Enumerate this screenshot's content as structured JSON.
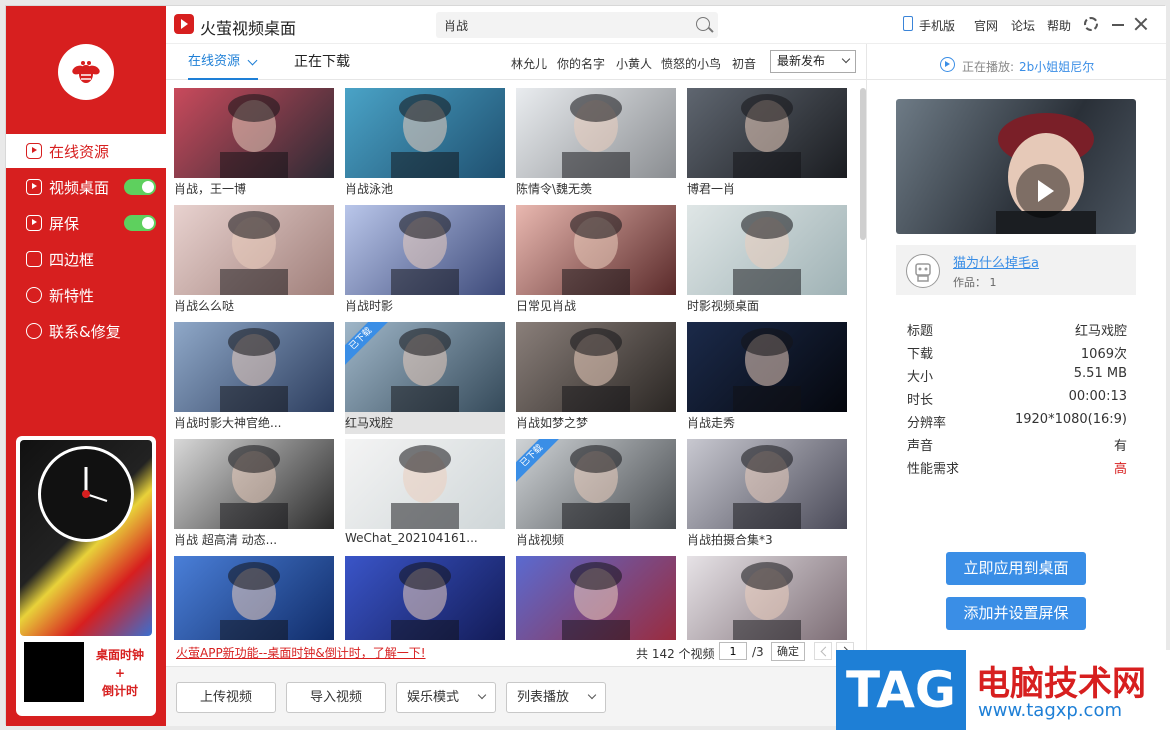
{
  "app": {
    "title": "火萤视频桌面"
  },
  "search": {
    "value": "肖战"
  },
  "toolbar": {
    "phone": "手机版",
    "official": "官网",
    "forum": "论坛",
    "help": "帮助"
  },
  "sidebar": {
    "items": [
      {
        "label": "在线资源",
        "icon": "play-square-icon"
      },
      {
        "label": "视频桌面",
        "icon": "play-square-icon",
        "toggle": true
      },
      {
        "label": "屏保",
        "icon": "play-square-icon",
        "toggle": true
      },
      {
        "label": "四边框",
        "icon": "frame-icon"
      },
      {
        "label": "新特性",
        "icon": "bulb-icon"
      },
      {
        "label": "联系&修复",
        "icon": "chat-icon"
      }
    ],
    "promo_text": [
      "桌面时钟",
      "+",
      "倒计时"
    ]
  },
  "tabs": {
    "online": "在线资源",
    "downloading": "正在下载"
  },
  "tags": [
    "林允儿",
    "你的名字",
    "小黄人",
    "愤怒的小鸟",
    "初音"
  ],
  "sort": {
    "selected": "最新发布"
  },
  "videos": [
    {
      "caption": "肖战，王一博",
      "downloaded": false,
      "c1": "#c94a5c",
      "c2": "#2a2a33"
    },
    {
      "caption": "肖战泳池",
      "downloaded": false,
      "c1": "#4aa3c7",
      "c2": "#1f5070"
    },
    {
      "caption": "陈情令\\魏无羡",
      "downloaded": false,
      "c1": "#e9ecef",
      "c2": "#8a8d91"
    },
    {
      "caption": "博君一肖",
      "downloaded": false,
      "c1": "#5f6670",
      "c2": "#1a1c20"
    },
    {
      "caption": "肖战么么哒",
      "downloaded": false,
      "c1": "#e8d2cf",
      "c2": "#a07f7a"
    },
    {
      "caption": "肖战时影",
      "downloaded": false,
      "c1": "#b9c6ea",
      "c2": "#3d4a7a"
    },
    {
      "caption": "日常见肖战",
      "downloaded": false,
      "c1": "#e9b8b0",
      "c2": "#5a2a2a"
    },
    {
      "caption": "时影视频桌面",
      "downloaded": false,
      "c1": "#dfe6e6",
      "c2": "#9fb2b5"
    },
    {
      "caption": "肖战时影大神官绝...",
      "downloaded": false,
      "c1": "#8fa8c8",
      "c2": "#2c3d5e"
    },
    {
      "caption": "红马戏腔",
      "downloaded": true,
      "c1": "#9fb6c8",
      "c2": "#354a5a"
    },
    {
      "caption": "肖战如梦之梦",
      "downloaded": false,
      "c1": "#8a7f7a",
      "c2": "#2a2623"
    },
    {
      "caption": "肖战走秀",
      "downloaded": false,
      "c1": "#1b2a4a",
      "c2": "#05070d"
    },
    {
      "caption": "肖战 超高清 动态...",
      "downloaded": false,
      "c1": "#d8d8d8",
      "c2": "#2a2a2a"
    },
    {
      "caption": "WeChat_202104161...",
      "downloaded": false,
      "c1": "#f4f4f4",
      "c2": "#cfd6d8"
    },
    {
      "caption": "肖战视频",
      "downloaded": true,
      "c1": "#cfd3d6",
      "c2": "#4a4e52"
    },
    {
      "caption": "肖战拍摄合集*3",
      "downloaded": false,
      "c1": "#c8c8d0",
      "c2": "#4a4a58"
    },
    {
      "caption": "",
      "downloaded": false,
      "c1": "#4a7fd8",
      "c2": "#0f2a66"
    },
    {
      "caption": "",
      "downloaded": false,
      "c1": "#3a55c8",
      "c2": "#121a55"
    },
    {
      "caption": "",
      "downloaded": false,
      "c1": "#5a6ad0",
      "c2": "#9c2a3a"
    },
    {
      "caption": "",
      "downloaded": false,
      "c1": "#e6e2e6",
      "c2": "#7a6a72"
    }
  ],
  "downloaded_label": "已下载",
  "notice": "火萤APP新功能--桌面时钟&倒计时，了解一下!",
  "pager": {
    "total": "共 142 个视频",
    "page": "1",
    "of": "/3",
    "confirm": "确定"
  },
  "bottom": {
    "upload": "上传视频",
    "import": "导入视频",
    "mode": "娱乐模式",
    "playlist": "列表播放"
  },
  "now_playing": {
    "label": "正在播放:",
    "value": "2b小姐姐尼尔"
  },
  "author": {
    "name": "猫为什么掉毛a",
    "works": "作品： 1"
  },
  "info": [
    {
      "k": "标题",
      "v": "红马戏腔"
    },
    {
      "k": "下载",
      "v": "1069次"
    },
    {
      "k": "大小",
      "v": "5.51 MB"
    },
    {
      "k": "时长",
      "v": "00:00:13"
    },
    {
      "k": "分辨率",
      "v": "1920*1080(16:9)"
    },
    {
      "k": "声音",
      "v": "有"
    },
    {
      "k": "性能需求",
      "v": "高",
      "color": "#d71f1f"
    }
  ],
  "actions": {
    "apply": "立即应用到桌面",
    "screensaver": "添加并设置屏保"
  },
  "watermark": {
    "tag": "TAG",
    "title": "电脑技术网",
    "url": "www.tagxp.com"
  },
  "colors": {
    "brand": "#d71f1f",
    "accent": "#3a8ee6"
  }
}
